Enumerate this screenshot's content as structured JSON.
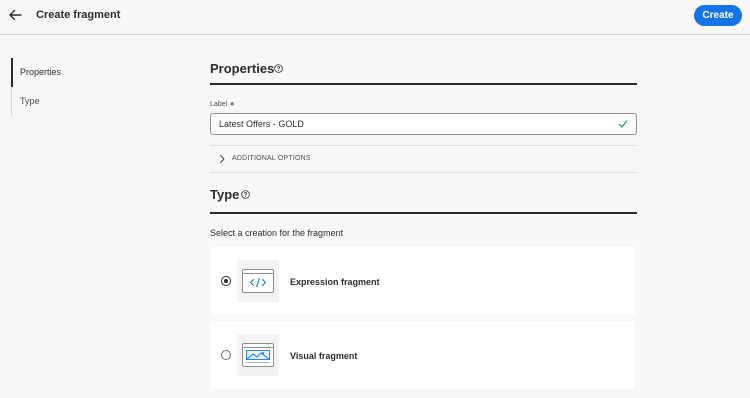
{
  "header": {
    "title": "Create fragment",
    "create_label": "Create",
    "back_icon": "arrow-left-icon"
  },
  "sidebar": {
    "items": [
      {
        "label": "Properties",
        "active": true
      },
      {
        "label": "Type",
        "active": false
      }
    ]
  },
  "properties": {
    "title": "Properties",
    "label_caption": "Label ∗",
    "label_value": "Latest Offers - GOLD",
    "additional_options": "ADDITIONAL OPTIONS"
  },
  "type_section": {
    "title": "Type",
    "subtitle": "Select a creation for the fragment",
    "options": [
      {
        "label": "Expression fragment",
        "selected": true,
        "icon": "code-window-icon"
      },
      {
        "label": "Visual fragment",
        "selected": false,
        "icon": "image-window-icon"
      }
    ]
  },
  "colors": {
    "accent": "#1473e6",
    "valid": "#2d9d78",
    "text": "#2c2c2c"
  }
}
